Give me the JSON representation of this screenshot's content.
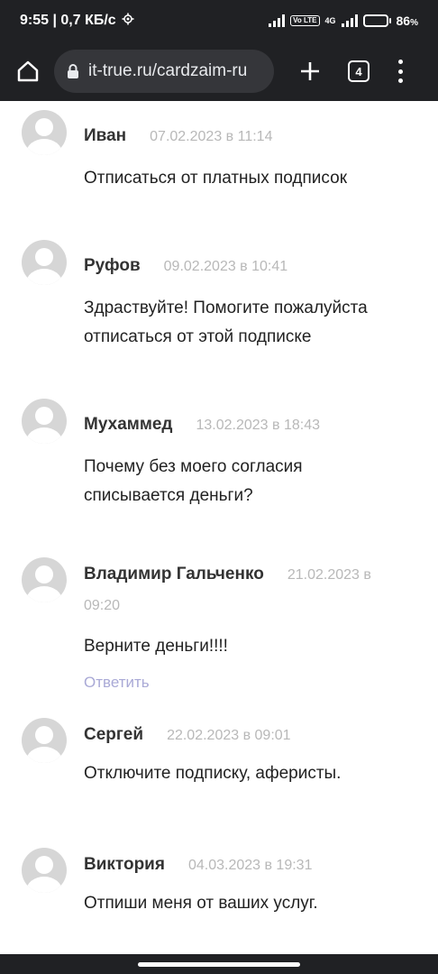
{
  "status_bar": {
    "time_speed": "9:55 | 0,7 КБ/с",
    "network": "4G",
    "battery_percent": "86",
    "battery_unit": "%",
    "battery_level": 0.86
  },
  "toolbar": {
    "url": "it-true.ru/cardzaim-ru",
    "tab_count": "4"
  },
  "comments": [
    {
      "author": "Иван",
      "date": "07.02.2023 в 11:14",
      "text": "Отписаться от платных подписок"
    },
    {
      "author": "Руфов",
      "date": "09.02.2023 в 10:41",
      "text": "Здраствуйте! Помогите пожалуйста отписаться от этой подписке"
    },
    {
      "author": "Мухаммед",
      "date": "13.02.2023 в 18:43",
      "text": "Почему без моего согласия списывается деньги?"
    },
    {
      "author": "Владимир Гальченко",
      "date": "21.02.2023 в 09:20",
      "text": "Верните деньги!!!!",
      "reply": "Ответить"
    },
    {
      "author": "Сергей",
      "date": "22.02.2023 в 09:01",
      "text": "Отключите подписку, аферисты."
    },
    {
      "author": "Виктория",
      "date": "04.03.2023 в 19:31",
      "text": "Отпиши меня от ваших услуг."
    }
  ],
  "icons": {
    "home": "home-icon",
    "lock": "lock-icon",
    "plus": "plus-icon",
    "menu": "more-vert-icon",
    "avatar": "default-avatar-icon"
  },
  "colors": {
    "chrome_bg": "#202124",
    "url_bg": "#35363a",
    "author": "#333333",
    "date": "#b8b8b8",
    "reply_link": "#a9a9d6"
  }
}
